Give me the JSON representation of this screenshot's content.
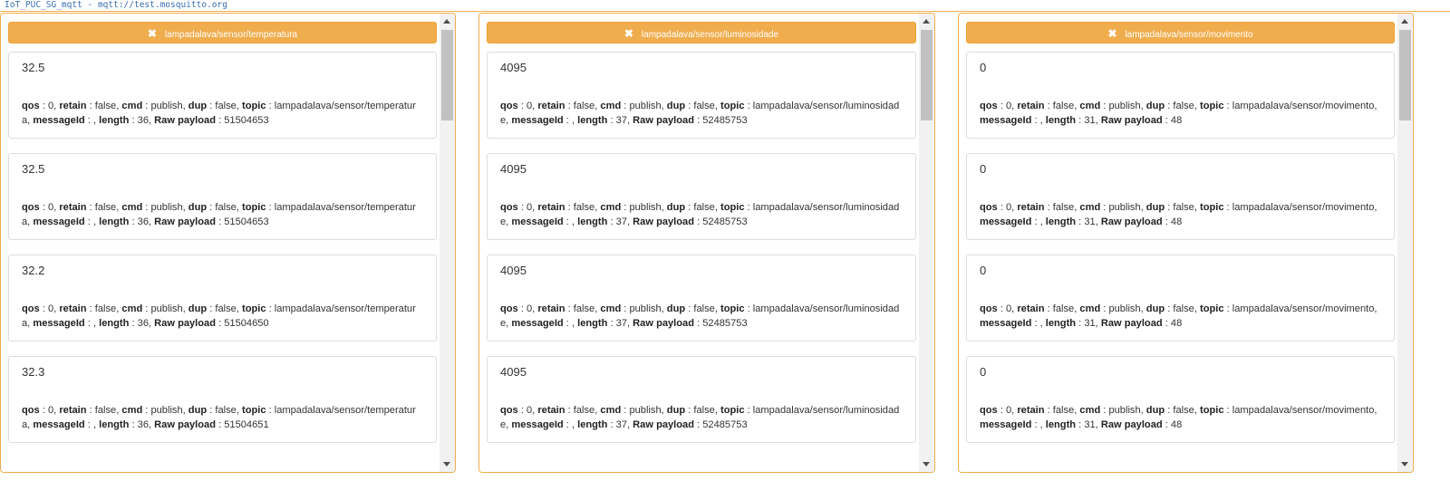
{
  "connection": {
    "title": "IoT_PUC_SG_mqtt - mqtt://test.mosquitto.org"
  },
  "labels": {
    "qos": "qos",
    "retain": "retain",
    "cmd": "cmd",
    "dup": "dup",
    "topic": "topic",
    "messageId": "messageId",
    "length": "length",
    "raw": "Raw payload"
  },
  "panels": [
    {
      "topic": "lampadalava/sensor/temperatura",
      "messages": [
        {
          "value": "32.5",
          "qos": "0",
          "retain": "false",
          "cmd": "publish",
          "dup": "false",
          "topic": "lampadalava/sensor/temperatura",
          "messageId": "",
          "length": "36",
          "raw": "51504653"
        },
        {
          "value": "32.5",
          "qos": "0",
          "retain": "false",
          "cmd": "publish",
          "dup": "false",
          "topic": "lampadalava/sensor/temperatura",
          "messageId": "",
          "length": "36",
          "raw": "51504653"
        },
        {
          "value": "32.2",
          "qos": "0",
          "retain": "false",
          "cmd": "publish",
          "dup": "false",
          "topic": "lampadalava/sensor/temperatura",
          "messageId": "",
          "length": "36",
          "raw": "51504650"
        },
        {
          "value": "32.3",
          "qos": "0",
          "retain": "false",
          "cmd": "publish",
          "dup": "false",
          "topic": "lampadalava/sensor/temperatura",
          "messageId": "",
          "length": "36",
          "raw": "51504651"
        }
      ]
    },
    {
      "topic": "lampadalava/sensor/luminosidade",
      "messages": [
        {
          "value": "4095",
          "qos": "0",
          "retain": "false",
          "cmd": "publish",
          "dup": "false",
          "topic": "lampadalava/sensor/luminosidade",
          "messageId": "",
          "length": "37",
          "raw": "52485753"
        },
        {
          "value": "4095",
          "qos": "0",
          "retain": "false",
          "cmd": "publish",
          "dup": "false",
          "topic": "lampadalava/sensor/luminosidade",
          "messageId": "",
          "length": "37",
          "raw": "52485753"
        },
        {
          "value": "4095",
          "qos": "0",
          "retain": "false",
          "cmd": "publish",
          "dup": "false",
          "topic": "lampadalava/sensor/luminosidade",
          "messageId": "",
          "length": "37",
          "raw": "52485753"
        },
        {
          "value": "4095",
          "qos": "0",
          "retain": "false",
          "cmd": "publish",
          "dup": "false",
          "topic": "lampadalava/sensor/luminosidade",
          "messageId": "",
          "length": "37",
          "raw": "52485753"
        }
      ]
    },
    {
      "topic": "lampadalava/sensor/movimento",
      "messages": [
        {
          "value": "0",
          "qos": "0",
          "retain": "false",
          "cmd": "publish",
          "dup": "false",
          "topic": "lampadalava/sensor/movimento",
          "messageId": "",
          "length": "31",
          "raw": "48"
        },
        {
          "value": "0",
          "qos": "0",
          "retain": "false",
          "cmd": "publish",
          "dup": "false",
          "topic": "lampadalava/sensor/movimento",
          "messageId": "",
          "length": "31",
          "raw": "48"
        },
        {
          "value": "0",
          "qos": "0",
          "retain": "false",
          "cmd": "publish",
          "dup": "false",
          "topic": "lampadalava/sensor/movimento",
          "messageId": "",
          "length": "31",
          "raw": "48"
        },
        {
          "value": "0",
          "qos": "0",
          "retain": "false",
          "cmd": "publish",
          "dup": "false",
          "topic": "lampadalava/sensor/movimento",
          "messageId": "",
          "length": "31",
          "raw": "48"
        }
      ]
    }
  ],
  "icons": {
    "close": "close-icon",
    "scroll_up": "scroll-up-arrow-icon",
    "scroll_down": "scroll-down-arrow-icon"
  },
  "colors": {
    "accent": "#f0ad4e",
    "connection_title": "#3a6fb0",
    "card_border": "#dddddd"
  }
}
